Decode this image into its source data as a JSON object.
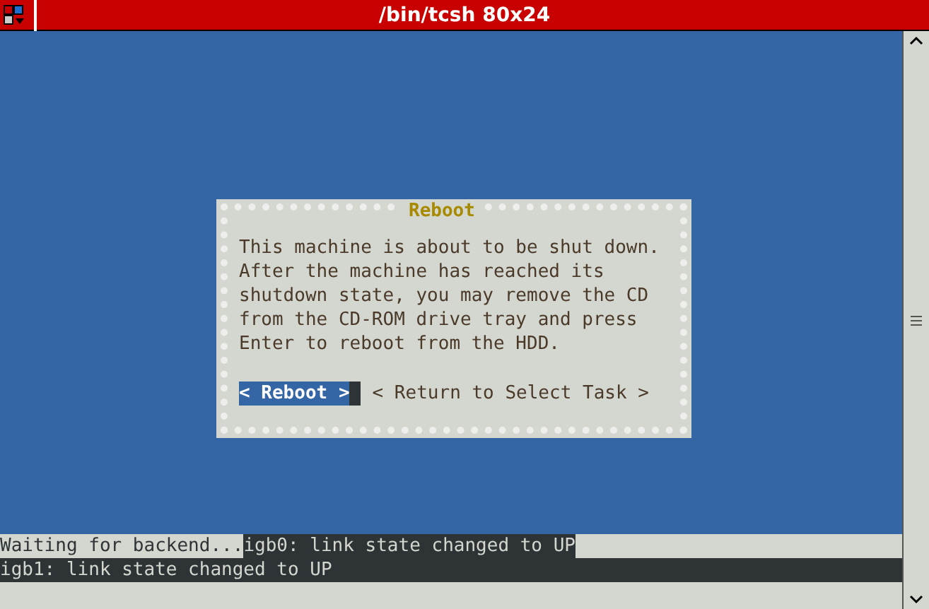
{
  "window": {
    "title": "/bin/tcsh 80x24"
  },
  "dialog": {
    "title": "Reboot",
    "message_lines": [
      "This machine is about to be shut down.",
      "After the machine has reached its",
      "shutdown state, you may remove the CD",
      "from the CD-ROM drive tray and press",
      "Enter to reboot from the HDD."
    ],
    "buttons": [
      {
        "label": "< Reboot >",
        "selected": true
      },
      {
        "label": "< Return to Select Task >",
        "selected": false
      }
    ]
  },
  "console_lines": [
    [
      {
        "text": "Waiting for backend...",
        "kind": "light"
      },
      {
        "text": "igb0: link state changed to UP",
        "kind": "dark"
      }
    ],
    [
      {
        "text": "igb1: link state changed to UP",
        "kind": "dark"
      }
    ]
  ]
}
